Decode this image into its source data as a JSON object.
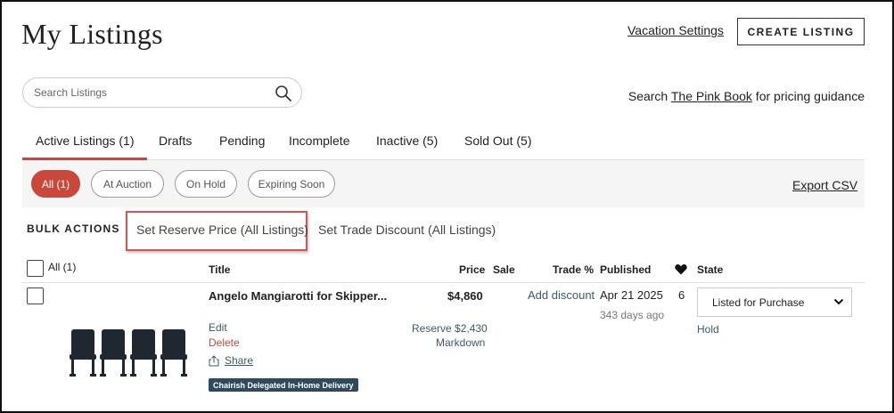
{
  "header": {
    "title": "My Listings",
    "vacation_link": "Vacation Settings",
    "create_button": "CREATE LISTING"
  },
  "search": {
    "placeholder": "Search Listings",
    "value": ""
  },
  "pinkbook": {
    "prefix": "Search ",
    "link": "The Pink Book",
    "suffix": " for pricing guidance"
  },
  "tabs": [
    {
      "label": "Active Listings (1)",
      "active": true
    },
    {
      "label": "Drafts"
    },
    {
      "label": "Pending"
    },
    {
      "label": "Incomplete"
    },
    {
      "label": "Inactive (5)"
    },
    {
      "label": "Sold Out (5)"
    }
  ],
  "filters": [
    {
      "label": "All (1)",
      "active": true
    },
    {
      "label": "At Auction"
    },
    {
      "label": "On Hold"
    },
    {
      "label": "Expiring Soon"
    }
  ],
  "export_label": "Export CSV",
  "bulk_actions": {
    "label": "BULK ACTIONS",
    "reserve": "Set Reserve Price (All Listings)",
    "trade": "Set Trade Discount (All Listings)"
  },
  "table": {
    "select_all_label": "All (1)",
    "columns": {
      "title": "Title",
      "price": "Price",
      "sale": "Sale",
      "trade": "Trade %",
      "published": "Published",
      "state": "State"
    }
  },
  "listing": {
    "title": "Angelo Mangiarotti for Skipper...",
    "price": "$4,860",
    "add_discount": "Add discount",
    "published_date": "Apr 21 2025",
    "published_ago": "343 days ago",
    "favorites": "6",
    "state": "Listed for Purchase",
    "hold": "Hold",
    "edit": "Edit",
    "delete": "Delete",
    "share": "Share",
    "reserve": "Reserve $2,430",
    "markdown": "Markdown",
    "badge": "Chairish Delegated In-Home Delivery"
  },
  "colors": {
    "accent_red": "#c9473b",
    "link_slate": "#3e5a6b",
    "badge_bg": "#2f4a5c",
    "highlight_box": "#d9534f"
  }
}
